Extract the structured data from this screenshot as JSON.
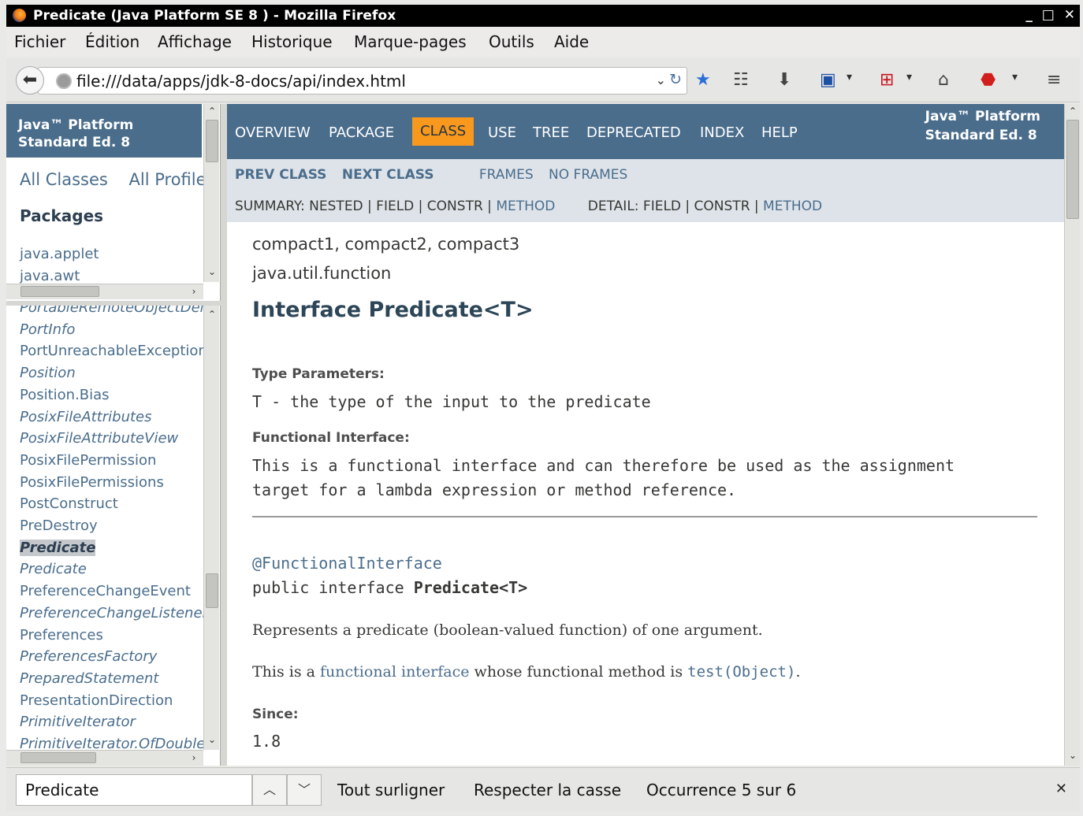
{
  "window": {
    "title": "Predicate (Java Platform SE 8 ) - Mozilla Firefox",
    "controls": [
      "_",
      "□",
      "✕"
    ]
  },
  "menu": [
    "Fichier",
    "Édition",
    "Affichage",
    "Historique",
    "Marque-pages",
    "Outils",
    "Aide"
  ],
  "navbar": {
    "url": "file:///data/apps/jdk-8-docs/api/index.html"
  },
  "left_top": {
    "banner": "Java™ Platform\nStandard Ed. 8",
    "all_classes": "All Classes",
    "all_profiles": "All Profiles",
    "packages_title": "Packages",
    "packages": [
      "java.applet",
      "java.awt"
    ]
  },
  "left_bottom": {
    "classes": [
      {
        "name": "PortableRemoteObjectDelegate",
        "italic": true
      },
      {
        "name": "PortInfo",
        "italic": true
      },
      {
        "name": "PortUnreachableException",
        "italic": false
      },
      {
        "name": "Position",
        "italic": true
      },
      {
        "name": "Position.Bias",
        "italic": false
      },
      {
        "name": "PosixFileAttributes",
        "italic": true
      },
      {
        "name": "PosixFileAttributeView",
        "italic": true
      },
      {
        "name": "PosixFilePermission",
        "italic": false
      },
      {
        "name": "PosixFilePermissions",
        "italic": false
      },
      {
        "name": "PostConstruct",
        "italic": false
      },
      {
        "name": "PreDestroy",
        "italic": false
      },
      {
        "name": "Predicate",
        "italic": true,
        "selected": true
      },
      {
        "name": "Predicate",
        "italic": true
      },
      {
        "name": "PreferenceChangeEvent",
        "italic": false
      },
      {
        "name": "PreferenceChangeListener",
        "italic": true
      },
      {
        "name": "Preferences",
        "italic": false
      },
      {
        "name": "PreferencesFactory",
        "italic": true
      },
      {
        "name": "PreparedStatement",
        "italic": true
      },
      {
        "name": "PresentationDirection",
        "italic": false
      },
      {
        "name": "PrimitiveIterator",
        "italic": true
      },
      {
        "name": "PrimitiveIterator.OfDouble",
        "italic": true
      }
    ]
  },
  "main": {
    "topnav": {
      "overview": "OVERVIEW",
      "package": "PACKAGE",
      "class": "CLASS",
      "use": "USE",
      "tree": "TREE",
      "deprecated": "DEPRECATED",
      "index": "INDEX",
      "help": "HELP",
      "about": "Java™ Platform\nStandard Ed. 8"
    },
    "subnav": {
      "prev_class": "PREV CLASS",
      "next_class": "NEXT CLASS",
      "frames": "FRAMES",
      "no_frames": "NO FRAMES",
      "summary_prefix": "SUMMARY: NESTED | FIELD | CONSTR | ",
      "summary_method": "METHOD",
      "detail_prefix": "DETAIL: FIELD | CONSTR | ",
      "detail_method": "METHOD"
    },
    "profiles": "compact1, compact2, compact3",
    "package": "java.util.function",
    "title": "Interface Predicate<T>",
    "type_params_label": "Type Parameters:",
    "type_params_value": "T - the type of the input to the predicate",
    "functional_label": "Functional Interface:",
    "functional_line1": "This is a functional interface and can therefore be used as the assignment",
    "functional_line2": "target for a lambda expression or method reference.",
    "annotation": "@FunctionalInterface",
    "decl_prefix": "public interface ",
    "decl_name": "Predicate<T>",
    "description": "Represents a predicate (boolean-valued function) of one argument.",
    "fi_prefix": "This is a ",
    "fi_link": "functional interface",
    "fi_middle": " whose functional method is ",
    "fi_method": "test(Object)",
    "fi_suffix": ".",
    "since_label": "Since:",
    "since_value": "1.8"
  },
  "findbar": {
    "query": "Predicate",
    "highlight_all": "Tout surligner",
    "match_case": "Respecter la casse",
    "status": "Occurrence 5 sur 6"
  },
  "colors": {
    "java_blue": "#4a6d8c",
    "class_tab": "#f8981d",
    "subnav_bg": "#dee3e9"
  }
}
